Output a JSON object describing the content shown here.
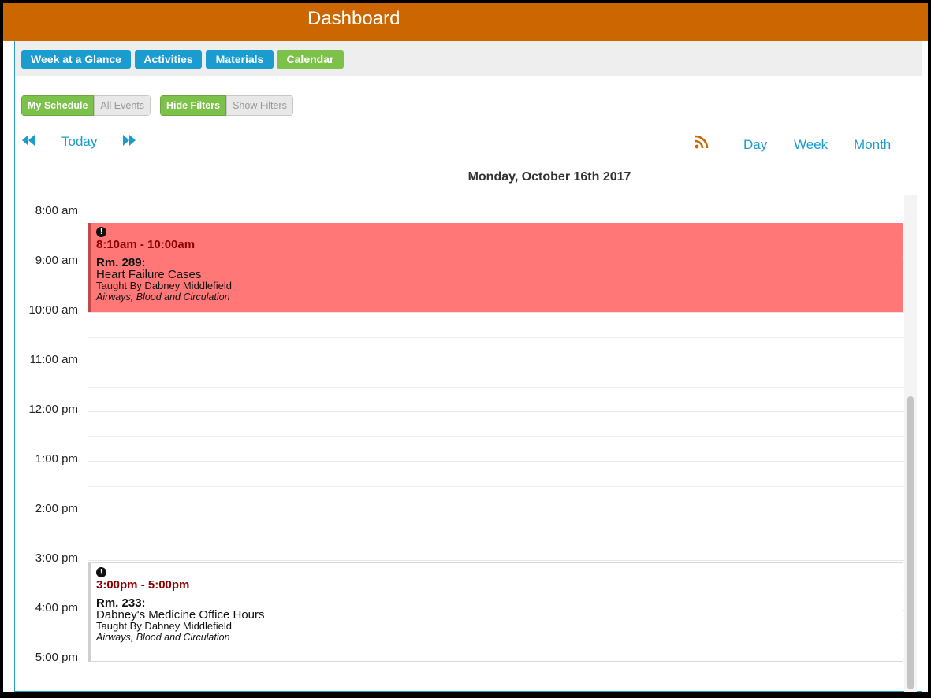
{
  "header": {
    "title": "Dashboard"
  },
  "tabs": [
    {
      "label": "Week at a Glance"
    },
    {
      "label": "Activities"
    },
    {
      "label": "Materials"
    },
    {
      "label": "Calendar"
    }
  ],
  "filters": {
    "my_schedule": "My Schedule",
    "all_events": "All Events",
    "hide_filters": "Hide Filters",
    "show_filters": "Show Filters"
  },
  "nav": {
    "prev_icon": "double-left-arrow-icon",
    "today": "Today",
    "next_icon": "double-right-arrow-icon",
    "rss_icon": "rss-feed-icon",
    "day": "Day",
    "week": "Week",
    "month": "Month"
  },
  "date_title": "Monday, October 16th 2017",
  "time_labels": [
    "8:00 am",
    "9:00 am",
    "10:00 am",
    "11:00 am",
    "12:00 pm",
    "1:00 pm",
    "2:00 pm",
    "3:00 pm",
    "4:00 pm",
    "5:00 pm"
  ],
  "events": [
    {
      "icon": "alert-icon",
      "time": "8:10am - 10:00am",
      "room": "Rm. 289:",
      "title": "Heart Failure Cases",
      "teacher": "Taught By Dabney Middlefield",
      "course": "Airways, Blood and Circulation",
      "color": "#ff7777"
    },
    {
      "icon": "alert-icon",
      "time": "3:00pm - 5:00pm",
      "room": "Rm. 233:",
      "title": "Dabney's Medicine Office Hours",
      "teacher": "Taught By Dabney Middlefield",
      "course": "Airways, Blood and Circulation",
      "color": "#ffffff"
    }
  ],
  "colors": {
    "header": "#cc6600",
    "tab_blue": "#1a9ccf",
    "tab_green": "#7cc14a",
    "event_red": "#ff7777",
    "event_time": "#8b0000"
  }
}
